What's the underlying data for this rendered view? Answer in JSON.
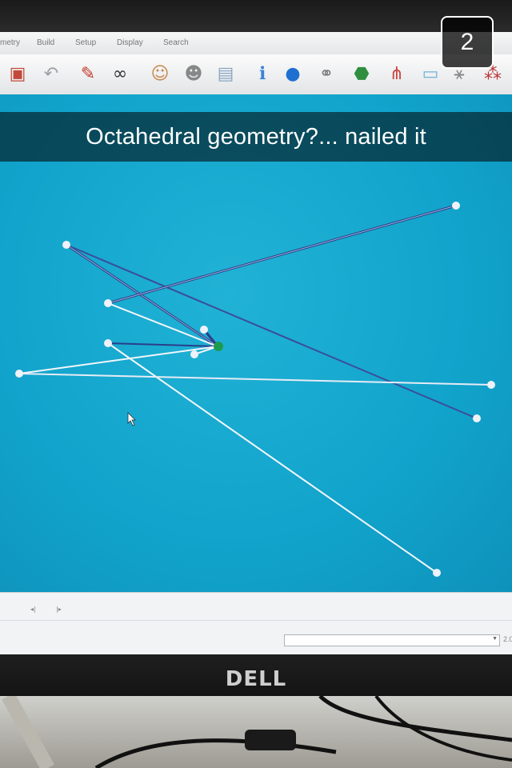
{
  "menu": {
    "items": [
      "metry",
      "Build",
      "Setup",
      "Display",
      "Search"
    ]
  },
  "toolbar": {
    "icons": [
      "save-icon",
      "undo-icon",
      "edit-icon",
      "glasses-icon",
      "person-icon",
      "person-gray-icon",
      "window-icon",
      "info-icon",
      "info-blue-icon",
      "molecule-icon",
      "surface-icon",
      "spectrum-icon",
      "plane-icon",
      "vibration-icon",
      "atoms-icon"
    ]
  },
  "statusbar": {
    "prev_glyph": "◂|",
    "next_glyph": "|▸",
    "right_value": "2.0"
  },
  "monitor": {
    "brand": "DELL"
  },
  "caption": {
    "text": "Octahedral geometry?... nailed it"
  },
  "snap_timer": {
    "seconds": "2"
  },
  "colors": {
    "viewport_bg": "#14a7cf",
    "bond": "#f2f6fb",
    "bond_dark": "#2a3f8a",
    "ligand": "#eef2f8",
    "center_atom": "#1e9a4f"
  }
}
